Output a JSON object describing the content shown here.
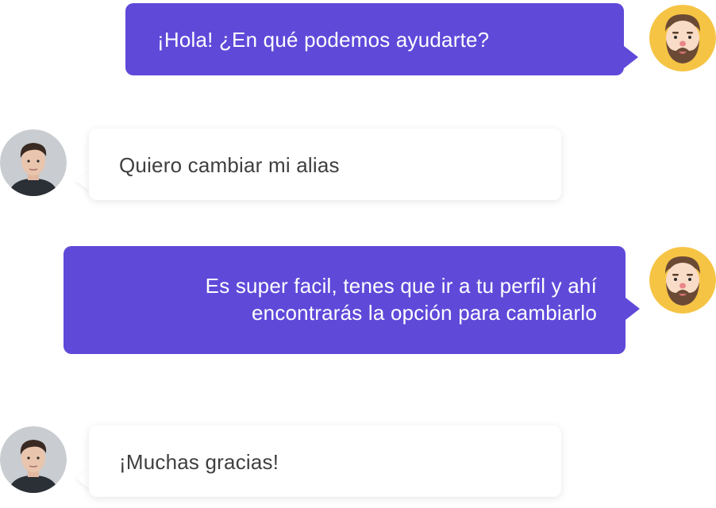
{
  "colors": {
    "agent_bubble": "#5f49d9",
    "agent_text": "#ffffff",
    "user_bubble": "#ffffff",
    "user_text": "#3f3f3f",
    "agent_avatar_bg": "#f6c445"
  },
  "messages": [
    {
      "sender": "agent",
      "avatar": "bearded-man-avatar",
      "lines": [
        "¡Hola! ¿En qué podemos ayudarte?"
      ]
    },
    {
      "sender": "user",
      "avatar": "young-man-photo-avatar",
      "lines": [
        "Quiero cambiar mi alias"
      ]
    },
    {
      "sender": "agent",
      "avatar": "bearded-man-avatar",
      "lines": [
        "Es super facil, tenes que ir a tu perfil y ahí",
        "encontrarás la opción para cambiarlo"
      ]
    },
    {
      "sender": "user",
      "avatar": "young-man-photo-avatar",
      "lines": [
        "¡Muchas gracias!"
      ]
    }
  ]
}
